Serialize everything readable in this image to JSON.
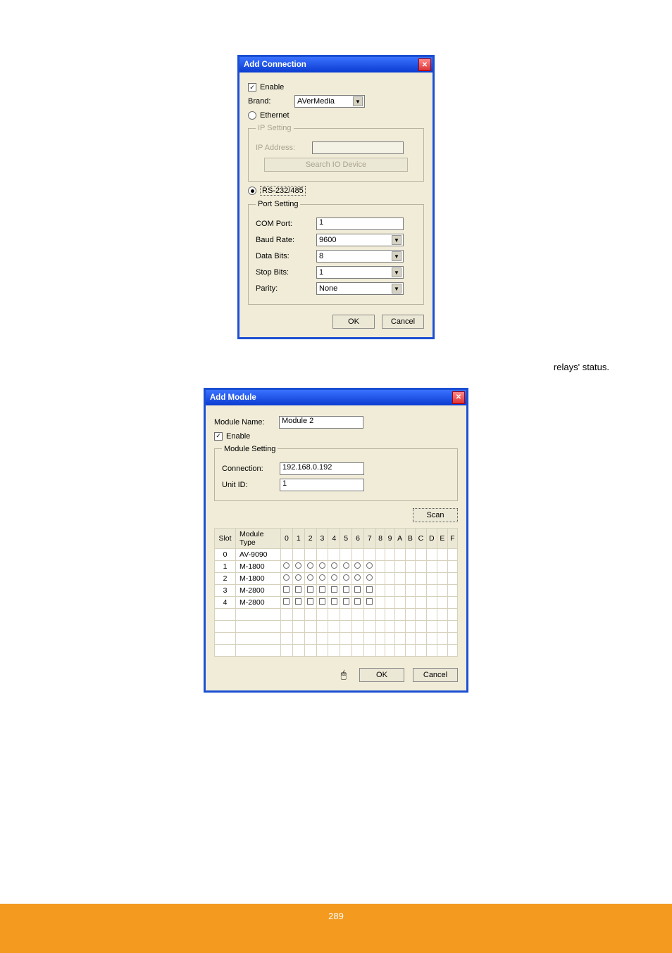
{
  "paragraphs": {
    "p1": "",
    "p2": "relays' status."
  },
  "dlg1": {
    "title": "Add Connection",
    "enable_label": "Enable",
    "enable_checked": true,
    "brand_label": "Brand:",
    "brand_value": "AVerMedia",
    "ethernet_label": "Ethernet",
    "ip_setting": {
      "legend": "IP Setting",
      "ip_address_label": "IP Address:",
      "ip_address_value": "",
      "search_btn": "Search IO Device"
    },
    "rs232_label": "RS-232/485",
    "port_setting": {
      "legend": "Port Setting",
      "com_port_label": "COM Port:",
      "com_port_value": "1",
      "baud_rate_label": "Baud Rate:",
      "baud_rate_value": "9600",
      "data_bits_label": "Data Bits:",
      "data_bits_value": "8",
      "stop_bits_label": "Stop Bits:",
      "stop_bits_value": "1",
      "parity_label": "Parity:",
      "parity_value": "None"
    },
    "ok": "OK",
    "cancel": "Cancel"
  },
  "dlg2": {
    "title": "Add Module",
    "module_name_label": "Module Name:",
    "module_name_value": "Module 2",
    "enable_label": "Enable",
    "enable_checked": true,
    "module_setting": {
      "legend": "Module Setting",
      "connection_label": "Connection:",
      "connection_value": "192.168.0.192",
      "unit_id_label": "Unit ID:",
      "unit_id_value": "1"
    },
    "scan_btn": "Scan",
    "table": {
      "headers": [
        "Slot",
        "Module Type",
        "0",
        "1",
        "2",
        "3",
        "4",
        "5",
        "6",
        "7",
        "8",
        "9",
        "A",
        "B",
        "C",
        "D",
        "E",
        "F"
      ],
      "rows": [
        {
          "slot": "0",
          "type": "AV-9090",
          "cells": "none"
        },
        {
          "slot": "1",
          "type": "M-1800",
          "cells": "radio8"
        },
        {
          "slot": "2",
          "type": "M-1800",
          "cells": "radio8"
        },
        {
          "slot": "3",
          "type": "M-2800",
          "cells": "check8"
        },
        {
          "slot": "4",
          "type": "M-2800",
          "cells": "check8"
        }
      ]
    },
    "ok": "OK",
    "cancel": "Cancel"
  },
  "footer": {
    "page_number": "289"
  }
}
